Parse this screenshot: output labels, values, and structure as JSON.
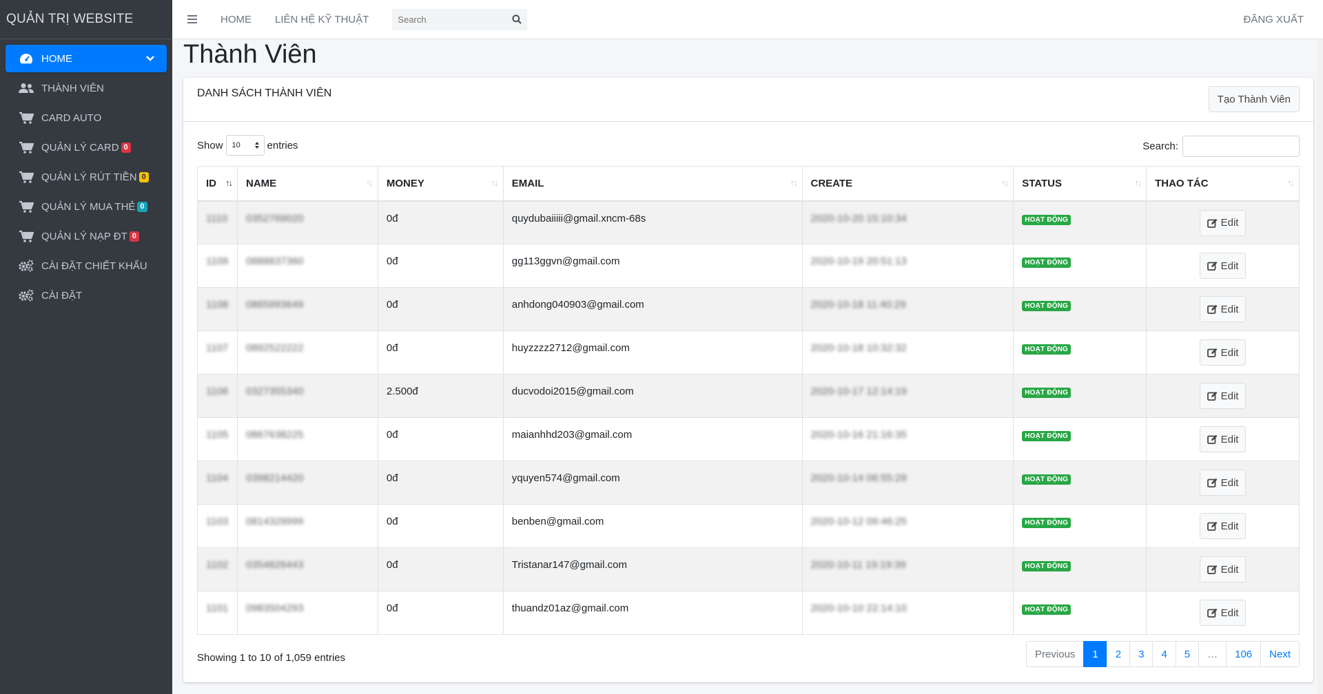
{
  "sidebar": {
    "brand": "QUẢN TRỊ WEBSITE",
    "items": [
      {
        "label": "HOME",
        "icon": "dashboard-icon",
        "active": true
      },
      {
        "label": "THÀNH VIÊN",
        "icon": "users-icon"
      },
      {
        "label": "CARD AUTO",
        "icon": "cart-icon"
      },
      {
        "label": "QUẢN LÝ CARD",
        "icon": "cart-icon",
        "badge": "0",
        "badge_color": "#dc3545"
      },
      {
        "label": "QUẢN LÝ RÚT TIỀN",
        "icon": "cart-icon",
        "badge": "0",
        "badge_color": "#ffc107"
      },
      {
        "label": "QUẢN LÝ MUA THẺ",
        "icon": "cart-icon",
        "badge": "0",
        "badge_color": "#17a2b8"
      },
      {
        "label": "QUẢN LÝ NẠP ĐT",
        "icon": "cart-icon",
        "badge": "0",
        "badge_color": "#dc3545"
      },
      {
        "label": "CÀI ĐẶT CHIẾT KHẤU",
        "icon": "gears-icon"
      },
      {
        "label": "CÀI ĐẶT",
        "icon": "gears-icon"
      }
    ]
  },
  "topbar": {
    "home": "HOME",
    "contact": "LIÊN HỆ KỸ THUẬT",
    "search_placeholder": "Search",
    "logout": "ĐĂNG XUẤT"
  },
  "page": {
    "title": "Thành Viên",
    "card_title": "DANH SÁCH THÀNH VIÊN",
    "create_button": "Tạo Thành Viên",
    "show_label": "Show",
    "page_size": "10",
    "entries_label": "entries",
    "search_label": "Search:"
  },
  "table": {
    "columns": [
      "ID",
      "NAME",
      "MONEY",
      "EMAIL",
      "CREATE",
      "STATUS",
      "THAO TÁC"
    ],
    "rows": [
      {
        "id": "1110",
        "name": "0352769020",
        "money": "0đ",
        "email": "quydubaiiiii@gmail.xncm-68s",
        "create": "2020-10-20 15:10:34",
        "status": "HOẠT ĐỘNG",
        "action": "Edit"
      },
      {
        "id": "1109",
        "name": "0888837360",
        "money": "0đ",
        "email": "gg113ggvn@gmail.com",
        "create": "2020-10-19 20:51:13",
        "status": "HOẠT ĐỘNG",
        "action": "Edit"
      },
      {
        "id": "1108",
        "name": "0865993649",
        "money": "0đ",
        "email": "anhdong040903@gmail.com",
        "create": "2020-10-18 11:40:29",
        "status": "HOẠT ĐỘNG",
        "action": "Edit"
      },
      {
        "id": "1107",
        "name": "0892522222",
        "money": "0đ",
        "email": "huyzzzz2712@gmail.com",
        "create": "2020-10-18 10:32:32",
        "status": "HOẠT ĐỘNG",
        "action": "Edit"
      },
      {
        "id": "1106",
        "name": "0327355340",
        "money": "2.500đ",
        "email": "ducvodoi2015@gmail.com",
        "create": "2020-10-17 12:14:19",
        "status": "HOẠT ĐỘNG",
        "action": "Edit"
      },
      {
        "id": "1105",
        "name": "0867638225",
        "money": "0đ",
        "email": "maianhhd203@gmail.com",
        "create": "2020-10-16 21:16:35",
        "status": "HOẠT ĐỘNG",
        "action": "Edit"
      },
      {
        "id": "1104",
        "name": "0398214420",
        "money": "0đ",
        "email": "yquyen574@gmail.com",
        "create": "2020-10-14 06:55:29",
        "status": "HOẠT ĐỘNG",
        "action": "Edit"
      },
      {
        "id": "1103",
        "name": "0814329999",
        "money": "0đ",
        "email": "benben@gmail.com",
        "create": "2020-10-12 09:46:25",
        "status": "HOẠT ĐỘNG",
        "action": "Edit"
      },
      {
        "id": "1102",
        "name": "0354826443",
        "money": "0đ",
        "email": "Tristanar147@gmail.com",
        "create": "2020-10-11 19:19:39",
        "status": "HOẠT ĐỘNG",
        "action": "Edit"
      },
      {
        "id": "1101",
        "name": "0983504293",
        "money": "0đ",
        "email": "thuandz01az@gmail.com",
        "create": "2020-10-10 22:14:10",
        "status": "HOẠT ĐỘNG",
        "action": "Edit"
      }
    ]
  },
  "footer": {
    "info": "Showing 1 to 10 of 1,059 entries",
    "pagination": [
      "Previous",
      "1",
      "2",
      "3",
      "4",
      "5",
      "…",
      "106",
      "Next"
    ],
    "active_page": "1"
  },
  "colors": {
    "sidebar_bg": "#343a40",
    "accent": "#007bff",
    "status_green": "#28a745"
  }
}
